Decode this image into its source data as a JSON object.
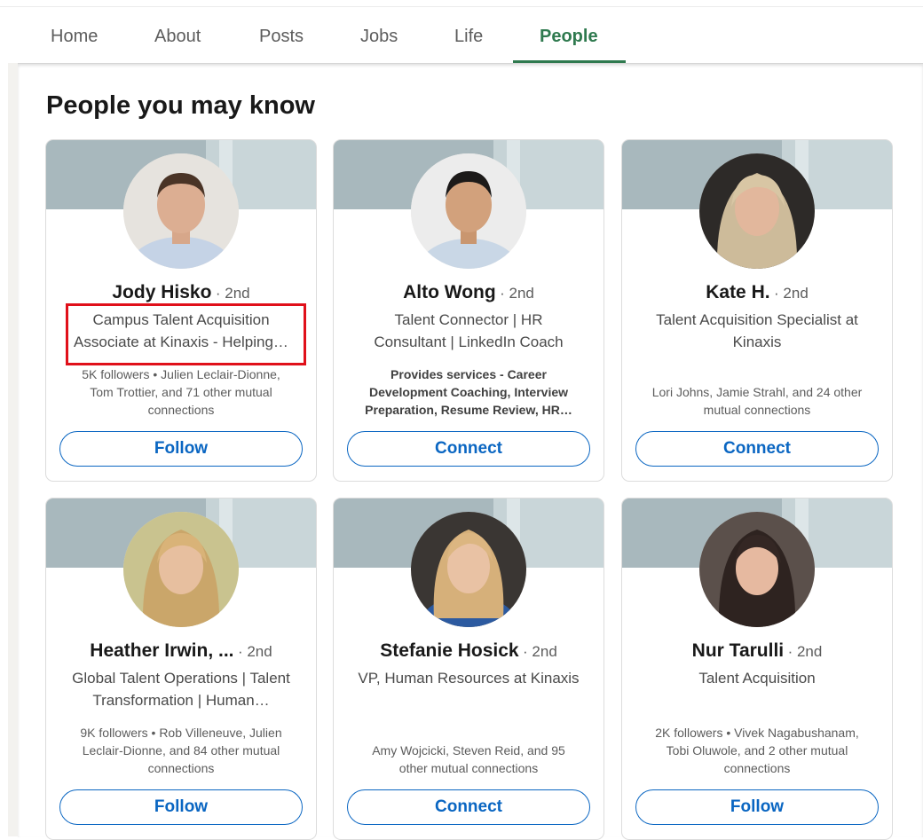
{
  "tabs": [
    {
      "label": "Home"
    },
    {
      "label": "About"
    },
    {
      "label": "Posts"
    },
    {
      "label": "Jobs"
    },
    {
      "label": "Life"
    },
    {
      "label": "People",
      "active": true
    }
  ],
  "section": {
    "title": "People you may know"
  },
  "colors": {
    "accent_green": "#2f7a4f",
    "link_blue": "#0a66c2",
    "highlight_red": "#e0101a"
  },
  "cards": [
    {
      "name": "Jody Hisko",
      "degree": "· 2nd",
      "headline": [
        "Campus Talent Acquisition",
        "Associate at Kinaxis - Helping…"
      ],
      "insight": [
        "5K followers • Julien Leclair-Dionne,",
        "Tom Trottier, and 71 other mutual",
        "connections"
      ],
      "action": "Follow",
      "avatar": "profile-photo-icon"
    },
    {
      "name": "Alto Wong",
      "degree": "· 2nd",
      "headline": [
        "Talent Connector | HR",
        "Consultant | LinkedIn Coach"
      ],
      "insight": [
        "Provides services - Career",
        "Development Coaching, Interview",
        "Preparation, Resume Review, HR…"
      ],
      "action": "Connect",
      "avatar": "profile-photo-icon"
    },
    {
      "name": "Kate H.",
      "degree": "· 2nd",
      "headline": [
        "Talent Acquisition Specialist at",
        "Kinaxis"
      ],
      "insight": [
        "Lori Johns, Jamie Strahl, and 24 other",
        "mutual connections"
      ],
      "action": "Connect",
      "avatar": "profile-photo-icon"
    },
    {
      "name": "Heather Irwin, ...",
      "degree": "· 2nd",
      "headline": [
        "Global Talent Operations | Talent",
        "Transformation | Human…"
      ],
      "insight": [
        "9K followers • Rob Villeneuve, Julien",
        "Leclair-Dionne, and 84 other mutual",
        "connections"
      ],
      "action": "Follow",
      "avatar": "profile-photo-icon"
    },
    {
      "name": "Stefanie Hosick",
      "degree": "· 2nd",
      "headline": [
        "VP, Human Resources at Kinaxis"
      ],
      "insight": [
        "Amy Wojcicki, Steven Reid, and 95",
        "other mutual connections"
      ],
      "action": "Connect",
      "avatar": "profile-photo-icon"
    },
    {
      "name": "Nur Tarulli",
      "degree": "· 2nd",
      "headline": [
        "Talent Acquisition"
      ],
      "insight": [
        "2K followers • Vivek Nagabushanam,",
        "Tobi Oluwole, and 2 other mutual",
        "connections"
      ],
      "action": "Follow",
      "avatar": "profile-photo-icon"
    }
  ]
}
